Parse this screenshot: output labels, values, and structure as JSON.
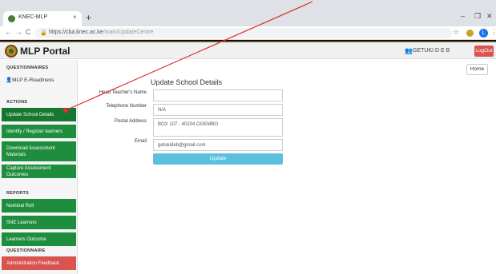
{
  "browser": {
    "tab_title": "KNEC-MLP",
    "tab_close": "×",
    "new_tab": "+",
    "minimize": "–",
    "maximize": "❐",
    "close": "✕",
    "back": "←",
    "forward": "→",
    "reload": "C",
    "url_host": "https://cba.knec.ac.ke",
    "url_path": "/main/UpdateCentre",
    "profile_initial": "L"
  },
  "header": {
    "title": "MLP Portal",
    "user": "GETUKI D E B",
    "logout_label": "LogOut"
  },
  "sidebar": {
    "section_questionnaires": "QUESTIONNAIRES",
    "readiness_link": "MLP E-Readiness",
    "section_actions": "ACTIONS",
    "actions": [
      {
        "label": "Update School Details"
      },
      {
        "label": "Identify / Register learners"
      },
      {
        "label": "Download Assessment Materials"
      },
      {
        "label": "Capture Assessment Outcomes"
      }
    ],
    "section_reports": "REPORTS",
    "reports": [
      {
        "label": "Nominal Roll"
      },
      {
        "label": "SNE Learners"
      },
      {
        "label": "Learners Outcome"
      }
    ],
    "section_questionnaire": "QUESTIONNAIRE",
    "feedback_label": "Administration Feedback"
  },
  "main": {
    "home_label": "Home",
    "form_title": "Update School Details",
    "fields": {
      "head_teacher": {
        "label": "Head Teacher's Name",
        "value": ""
      },
      "telephone": {
        "label": "Telephone Number",
        "value": "N/A"
      },
      "postal": {
        "label": "Postal Address",
        "value": "BOX 107 - 40204 OGEMBO"
      },
      "email": {
        "label": "Email",
        "value": "getukideb@gmail.com"
      }
    },
    "submit_label": "Update"
  },
  "colors": {
    "sidebar_green": "#1e8e3e",
    "logout_red": "#d9534f",
    "update_blue": "#5bc0de",
    "annotation_arrow": "#e03030"
  }
}
